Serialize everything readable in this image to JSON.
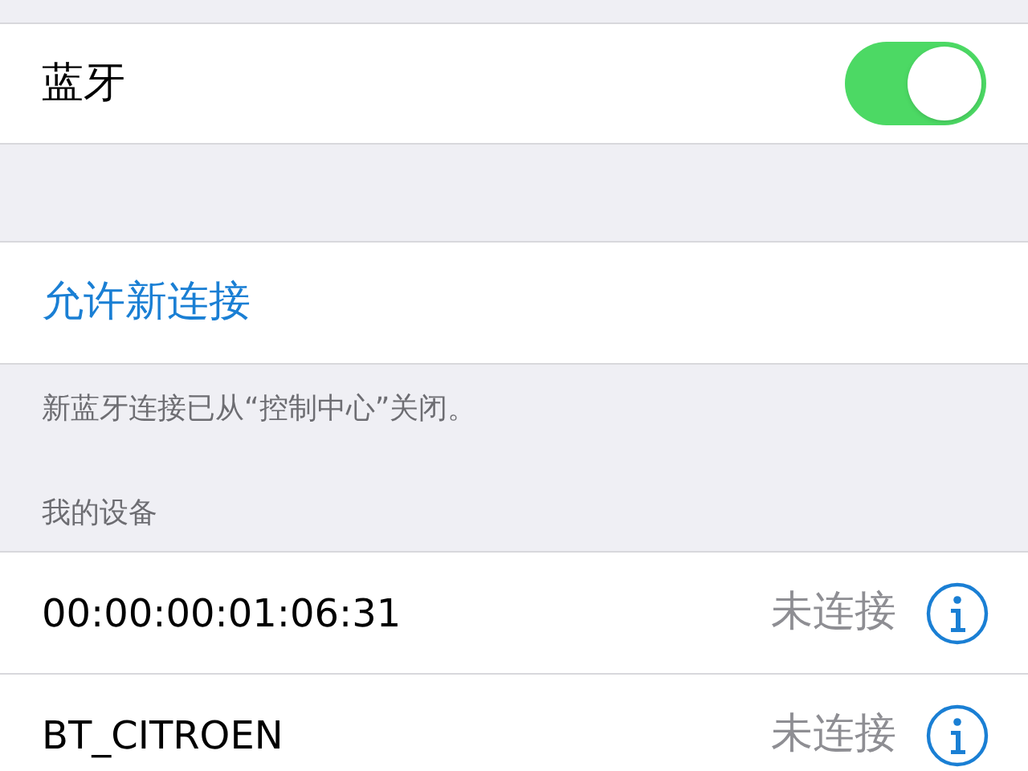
{
  "bluetooth": {
    "label": "蓝牙",
    "on": true
  },
  "allow_new_connections": {
    "label": "允许新连接"
  },
  "footer_note": "新蓝牙连接已从“控制中心”关闭。",
  "section_header": "我的设备",
  "devices": [
    {
      "name": "00:00:00:01:06:31",
      "status": "未连接"
    },
    {
      "name": "BT_CITROEN",
      "status": "未连接"
    }
  ]
}
